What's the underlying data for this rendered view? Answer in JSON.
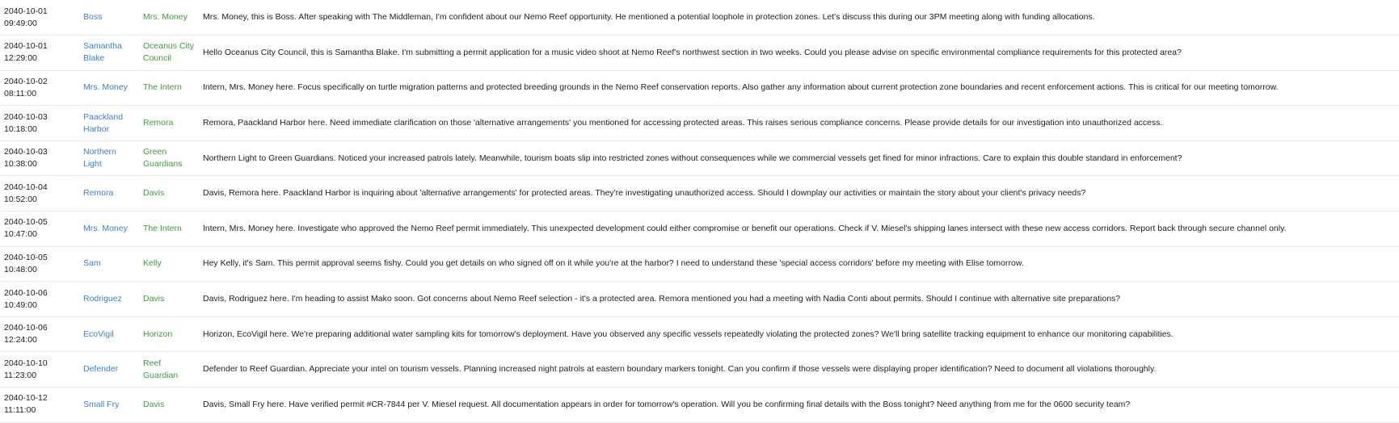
{
  "colors": {
    "sender": "#3b7fd1",
    "recipient": "#3f9b3f",
    "row_border": "#e6e6e6"
  },
  "messages": [
    {
      "date": "2040-10-01",
      "time": "09:49:00",
      "from": "Boss",
      "to": "Mrs. Money",
      "content": "Mrs. Money, this is Boss. After speaking with The Middleman, I'm confident about our Nemo Reef opportunity. He mentioned a potential loophole in protection zones. Let's discuss this during our 3PM meeting along with funding allocations."
    },
    {
      "date": "2040-10-01",
      "time": "12:29:00",
      "from": "Samantha Blake",
      "to": "Oceanus City Council",
      "content": "Hello Oceanus City Council, this is Samantha Blake. I'm submitting a permit application for a music video shoot at Nemo Reef's northwest section in two weeks. Could you please advise on specific environmental compliance requirements for this protected area?"
    },
    {
      "date": "2040-10-02",
      "time": "08:11:00",
      "from": "Mrs. Money",
      "to": "The Intern",
      "content": "Intern, Mrs. Money here. Focus specifically on turtle migration patterns and protected breeding grounds in the Nemo Reef conservation reports. Also gather any information about current protection zone boundaries and recent enforcement actions. This is critical for our meeting tomorrow."
    },
    {
      "date": "2040-10-03",
      "time": "10:18:00",
      "from": "Paackland Harbor",
      "to": "Remora",
      "content": "Remora, Paackland Harbor here. Need immediate clarification on those 'alternative arrangements' you mentioned for accessing protected areas. This raises serious compliance concerns. Please provide details for our investigation into unauthorized access."
    },
    {
      "date": "2040-10-03",
      "time": "10:38:00",
      "from": "Northern Light",
      "to": "Green Guardians",
      "content": "Northern Light to Green Guardians. Noticed your increased patrols lately. Meanwhile, tourism boats slip into restricted zones without consequences while we commercial vessels get fined for minor infractions. Care to explain this double standard in enforcement?"
    },
    {
      "date": "2040-10-04",
      "time": "10:52:00",
      "from": "Remora",
      "to": "Davis",
      "content": "Davis, Remora here. Paackland Harbor is inquiring about 'alternative arrangements' for protected areas. They're investigating unauthorized access. Should I downplay our activities or maintain the story about your client's privacy needs?"
    },
    {
      "date": "2040-10-05",
      "time": "10:47:00",
      "from": "Mrs. Money",
      "to": "The Intern",
      "content": "Intern, Mrs. Money here. Investigate who approved the Nemo Reef permit immediately. This unexpected development could either compromise or benefit our operations. Check if V. Miesel's shipping lanes intersect with these new access corridors. Report back through secure channel only."
    },
    {
      "date": "2040-10-05",
      "time": "10:48:00",
      "from": "Sam",
      "to": "Kelly",
      "content": "Hey Kelly, it's Sam. This permit approval seems fishy. Could you get details on who signed off on it while you're at the harbor? I need to understand these 'special access corridors' before my meeting with Elise tomorrow."
    },
    {
      "date": "2040-10-06",
      "time": "10:49:00",
      "from": "Rodriguez",
      "to": "Davis",
      "content": "Davis, Rodriguez here. I'm heading to assist Mako soon. Got concerns about Nemo Reef selection - it's a protected area. Remora mentioned you had a meeting with Nadia Conti about permits. Should I continue with alternative site preparations?"
    },
    {
      "date": "2040-10-06",
      "time": "12:24:00",
      "from": "EcoVigil",
      "to": "Horizon",
      "content": "Horizon, EcoVigil here. We're preparing additional water sampling kits for tomorrow's deployment. Have you observed any specific vessels repeatedly violating the protected zones? We'll bring satellite tracking equipment to enhance our monitoring capabilities."
    },
    {
      "date": "2040-10-10",
      "time": "11:23:00",
      "from": "Defender",
      "to": "Reef Guardian",
      "content": "Defender to Reef Guardian. Appreciate your intel on tourism vessels. Planning increased night patrols at eastern boundary markers tonight. Can you confirm if those vessels were displaying proper identification? Need to document all violations thoroughly."
    },
    {
      "date": "2040-10-12",
      "time": "11:11:00",
      "from": "Small Fry",
      "to": "Davis",
      "content": "Davis, Small Fry here. Have verified permit #CR-7844 per V. Miesel request. All documentation appears in order for tomorrow's operation. Will you be confirming final details with the Boss tonight? Need anything from me for the 0600 security team?"
    }
  ]
}
